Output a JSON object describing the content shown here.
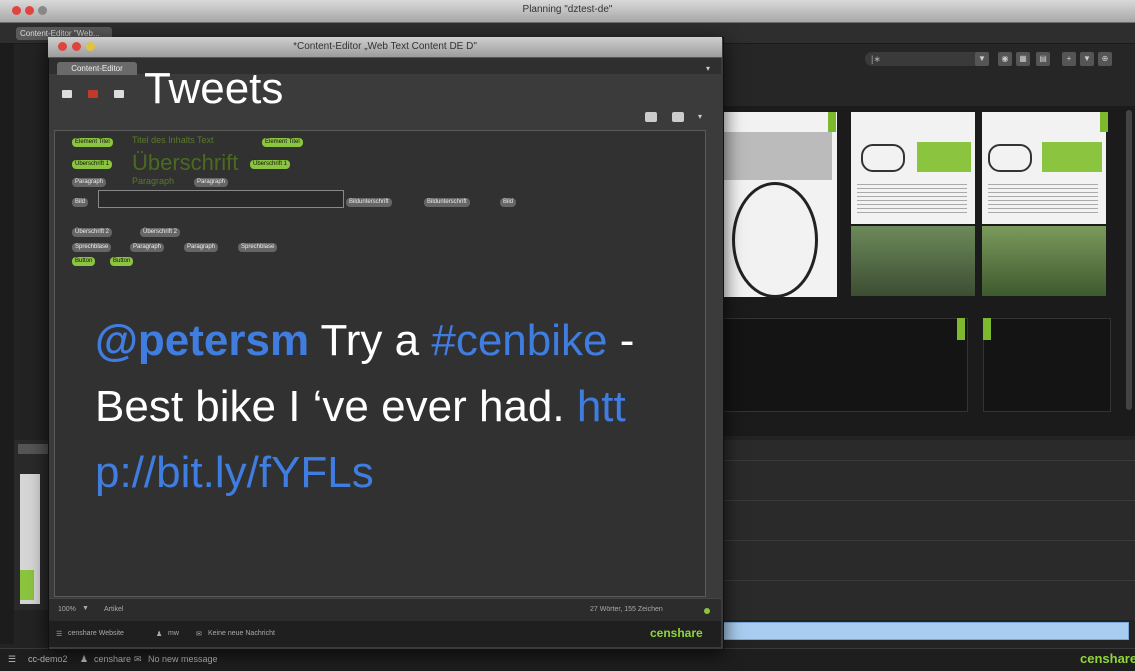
{
  "outer_window": {
    "title": "Planning \"dztest-de\"",
    "tab_label": "Content-Editor \"Web...",
    "search_value": "|∗"
  },
  "inner_window": {
    "title": "*Content-Editor „Web Text Content DE D\"",
    "tab_label": "Content-Editor",
    "heading": "Tweets",
    "editor": {
      "row1_tag_left": "Element Titel",
      "row1_faded": "Titel des Inhalts Text",
      "row1_tag_right": "Element Titel",
      "row2_tag_left": "Überschrift 1",
      "row2_big": "Überschrift",
      "row2_tag_right": "Überschrift 1",
      "row3_tag_left": "Paragraph",
      "row3_faded": "Paragraph",
      "row3_tag_right": "Paragraph",
      "row4_tag_left": "Bild",
      "row4_label1": "Bildunterschrift",
      "row4_label2": "Bildunterschrift",
      "row4_tag_right": "Bild",
      "row5_tag1": "Überschrift 2",
      "row5_tag2": "Überschrift 2",
      "row6_tag1": "Sprechblase",
      "row6_tag2": "Paragraph",
      "row6_tag3": "Paragraph",
      "row6_tag4": "Sprechblase",
      "row7_tag1": "Button",
      "row7_tag2": "Button"
    },
    "tweet": {
      "mention": "@petersm",
      "text1": " Try a ",
      "hashtag": "#cenbike",
      "text2": " - Best bike I ‘ve ever had. ",
      "link": "http://bit.ly/fYFLs"
    },
    "footer": {
      "zoom": "100%",
      "mode": "Artikel",
      "counts": "27 Wörter, 155 Zeichen"
    },
    "status": {
      "item1": "censhare Website",
      "item2": "mw",
      "item3": "Keine neue Nachricht",
      "brand": "censhare"
    }
  },
  "status_bar": {
    "item1": "cc-demo2",
    "item2": "censhare",
    "item3": "No new message",
    "brand": "censhare"
  },
  "colors": {
    "accent_green": "#8bc53f",
    "link_blue": "#3f7de0",
    "selection_blue": "#a9cdf0"
  }
}
